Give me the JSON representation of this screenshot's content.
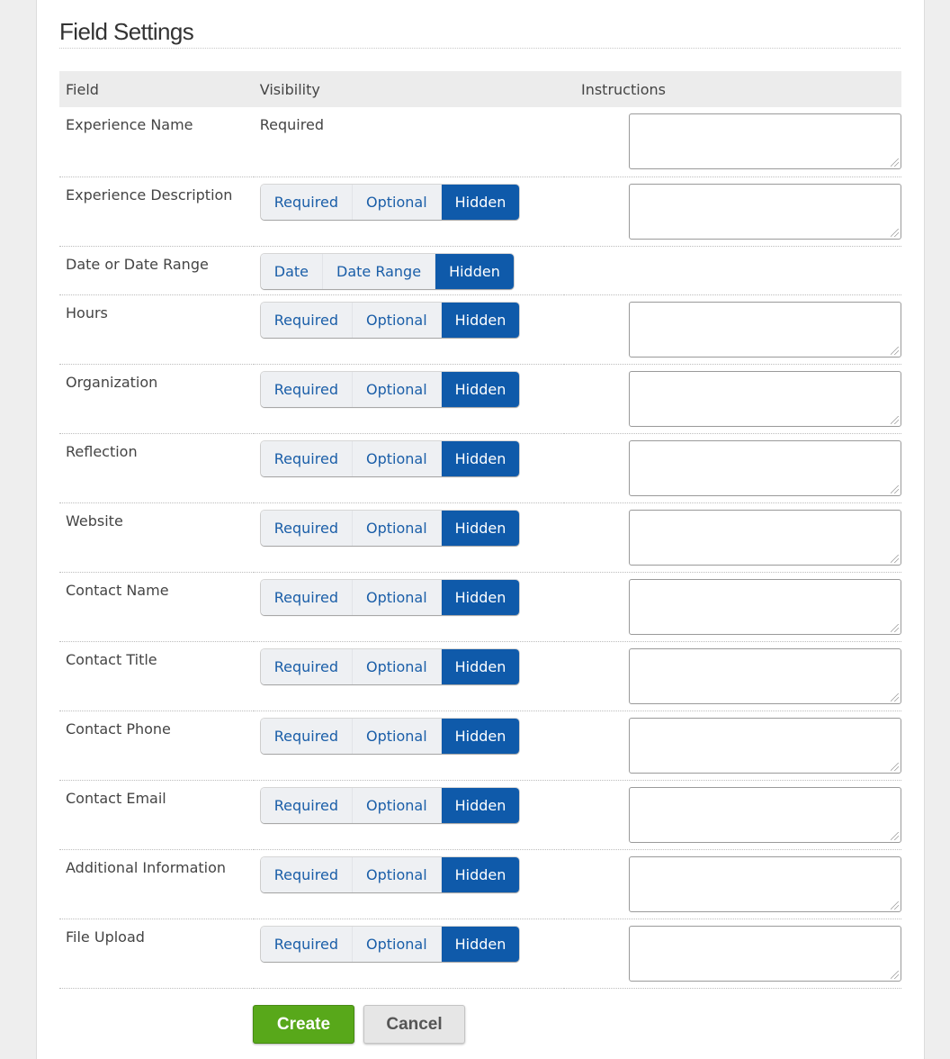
{
  "section": {
    "title": "Field Settings"
  },
  "table": {
    "headers": {
      "field": "Field",
      "visibility": "Visibility",
      "instructions": "Instructions"
    },
    "rows": [
      {
        "field": "Experience Name",
        "static_visibility": "Required",
        "has_instructions": true
      },
      {
        "field": "Experience Description",
        "options": [
          "Required",
          "Optional",
          "Hidden"
        ],
        "selected": "Hidden",
        "has_instructions": true
      },
      {
        "field": "Date or Date Range",
        "options": [
          "Date",
          "Date Range",
          "Hidden"
        ],
        "selected": "Hidden",
        "has_instructions": false
      },
      {
        "field": "Hours",
        "options": [
          "Required",
          "Optional",
          "Hidden"
        ],
        "selected": "Hidden",
        "has_instructions": true
      },
      {
        "field": "Organization",
        "options": [
          "Required",
          "Optional",
          "Hidden"
        ],
        "selected": "Hidden",
        "has_instructions": true
      },
      {
        "field": "Reflection",
        "options": [
          "Required",
          "Optional",
          "Hidden"
        ],
        "selected": "Hidden",
        "has_instructions": true
      },
      {
        "field": "Website",
        "options": [
          "Required",
          "Optional",
          "Hidden"
        ],
        "selected": "Hidden",
        "has_instructions": true
      },
      {
        "field": "Contact Name",
        "options": [
          "Required",
          "Optional",
          "Hidden"
        ],
        "selected": "Hidden",
        "has_instructions": true
      },
      {
        "field": "Contact Title",
        "options": [
          "Required",
          "Optional",
          "Hidden"
        ],
        "selected": "Hidden",
        "has_instructions": true
      },
      {
        "field": "Contact Phone",
        "options": [
          "Required",
          "Optional",
          "Hidden"
        ],
        "selected": "Hidden",
        "has_instructions": true
      },
      {
        "field": "Contact Email",
        "options": [
          "Required",
          "Optional",
          "Hidden"
        ],
        "selected": "Hidden",
        "has_instructions": true
      },
      {
        "field": "Additional Information",
        "options": [
          "Required",
          "Optional",
          "Hidden"
        ],
        "selected": "Hidden",
        "has_instructions": true
      },
      {
        "field": "File Upload",
        "options": [
          "Required",
          "Optional",
          "Hidden"
        ],
        "selected": "Hidden",
        "has_instructions": true
      }
    ]
  },
  "actions": {
    "create_label": "Create",
    "cancel_label": "Cancel"
  },
  "colors": {
    "accent": "#0f5aaa",
    "create": "#58a81a",
    "link": "#1a5ea8"
  }
}
